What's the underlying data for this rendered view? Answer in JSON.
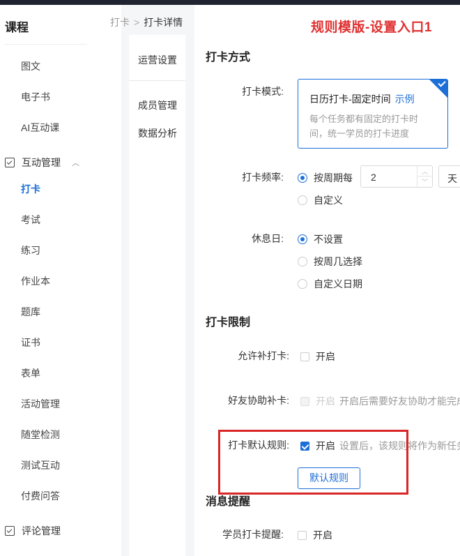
{
  "sidebar": {
    "title": "课程",
    "items_top": [
      "图文",
      "电子书",
      "AI互动课"
    ],
    "group_interact": "互动管理",
    "items_interact": [
      "打卡",
      "考试",
      "练习",
      "作业本",
      "题库",
      "证书",
      "表单",
      "活动管理",
      "随堂检测",
      "测试互动",
      "付费问答"
    ],
    "group_comment": "评论管理"
  },
  "breadcrumb": {
    "parent": "打卡",
    "sep": ">",
    "current": "打卡详情"
  },
  "subnav": [
    "运营设置",
    "成员管理",
    "数据分析"
  ],
  "annotation": "规则模版-设置入口1",
  "checkin_mode": {
    "section_title": "打卡方式",
    "mode_label": "打卡模式:",
    "card_title": "日历打卡-固定时间",
    "card_link": "示例",
    "card_desc": "每个任务都有固定的打卡时间，统一学员的打卡进度",
    "freq_label": "打卡频率:",
    "freq_option1": "按周期每",
    "freq_value": "2",
    "freq_unit": "天",
    "freq_option2": "自定义",
    "rest_label": "休息日:",
    "rest_options": [
      "不设置",
      "按周几选择",
      "自定义日期"
    ]
  },
  "limits": {
    "section_title": "打卡限制",
    "makeup_label": "允许补打卡:",
    "makeup_text": "开启",
    "friend_label": "好友协助补卡:",
    "friend_text": "开启",
    "friend_hint": "开启后需要好友协助才能完成",
    "default_label": "打卡默认规则:",
    "default_text": "开启",
    "default_hint": "设置后，该规则将作为新任务",
    "default_button": "默认规则"
  },
  "notify": {
    "section_title": "消息提醒",
    "student_label": "学员打卡提醒:",
    "student_text": "开启"
  },
  "colors": {
    "accent": "#1d6fd8",
    "annotation": "#e03030"
  }
}
